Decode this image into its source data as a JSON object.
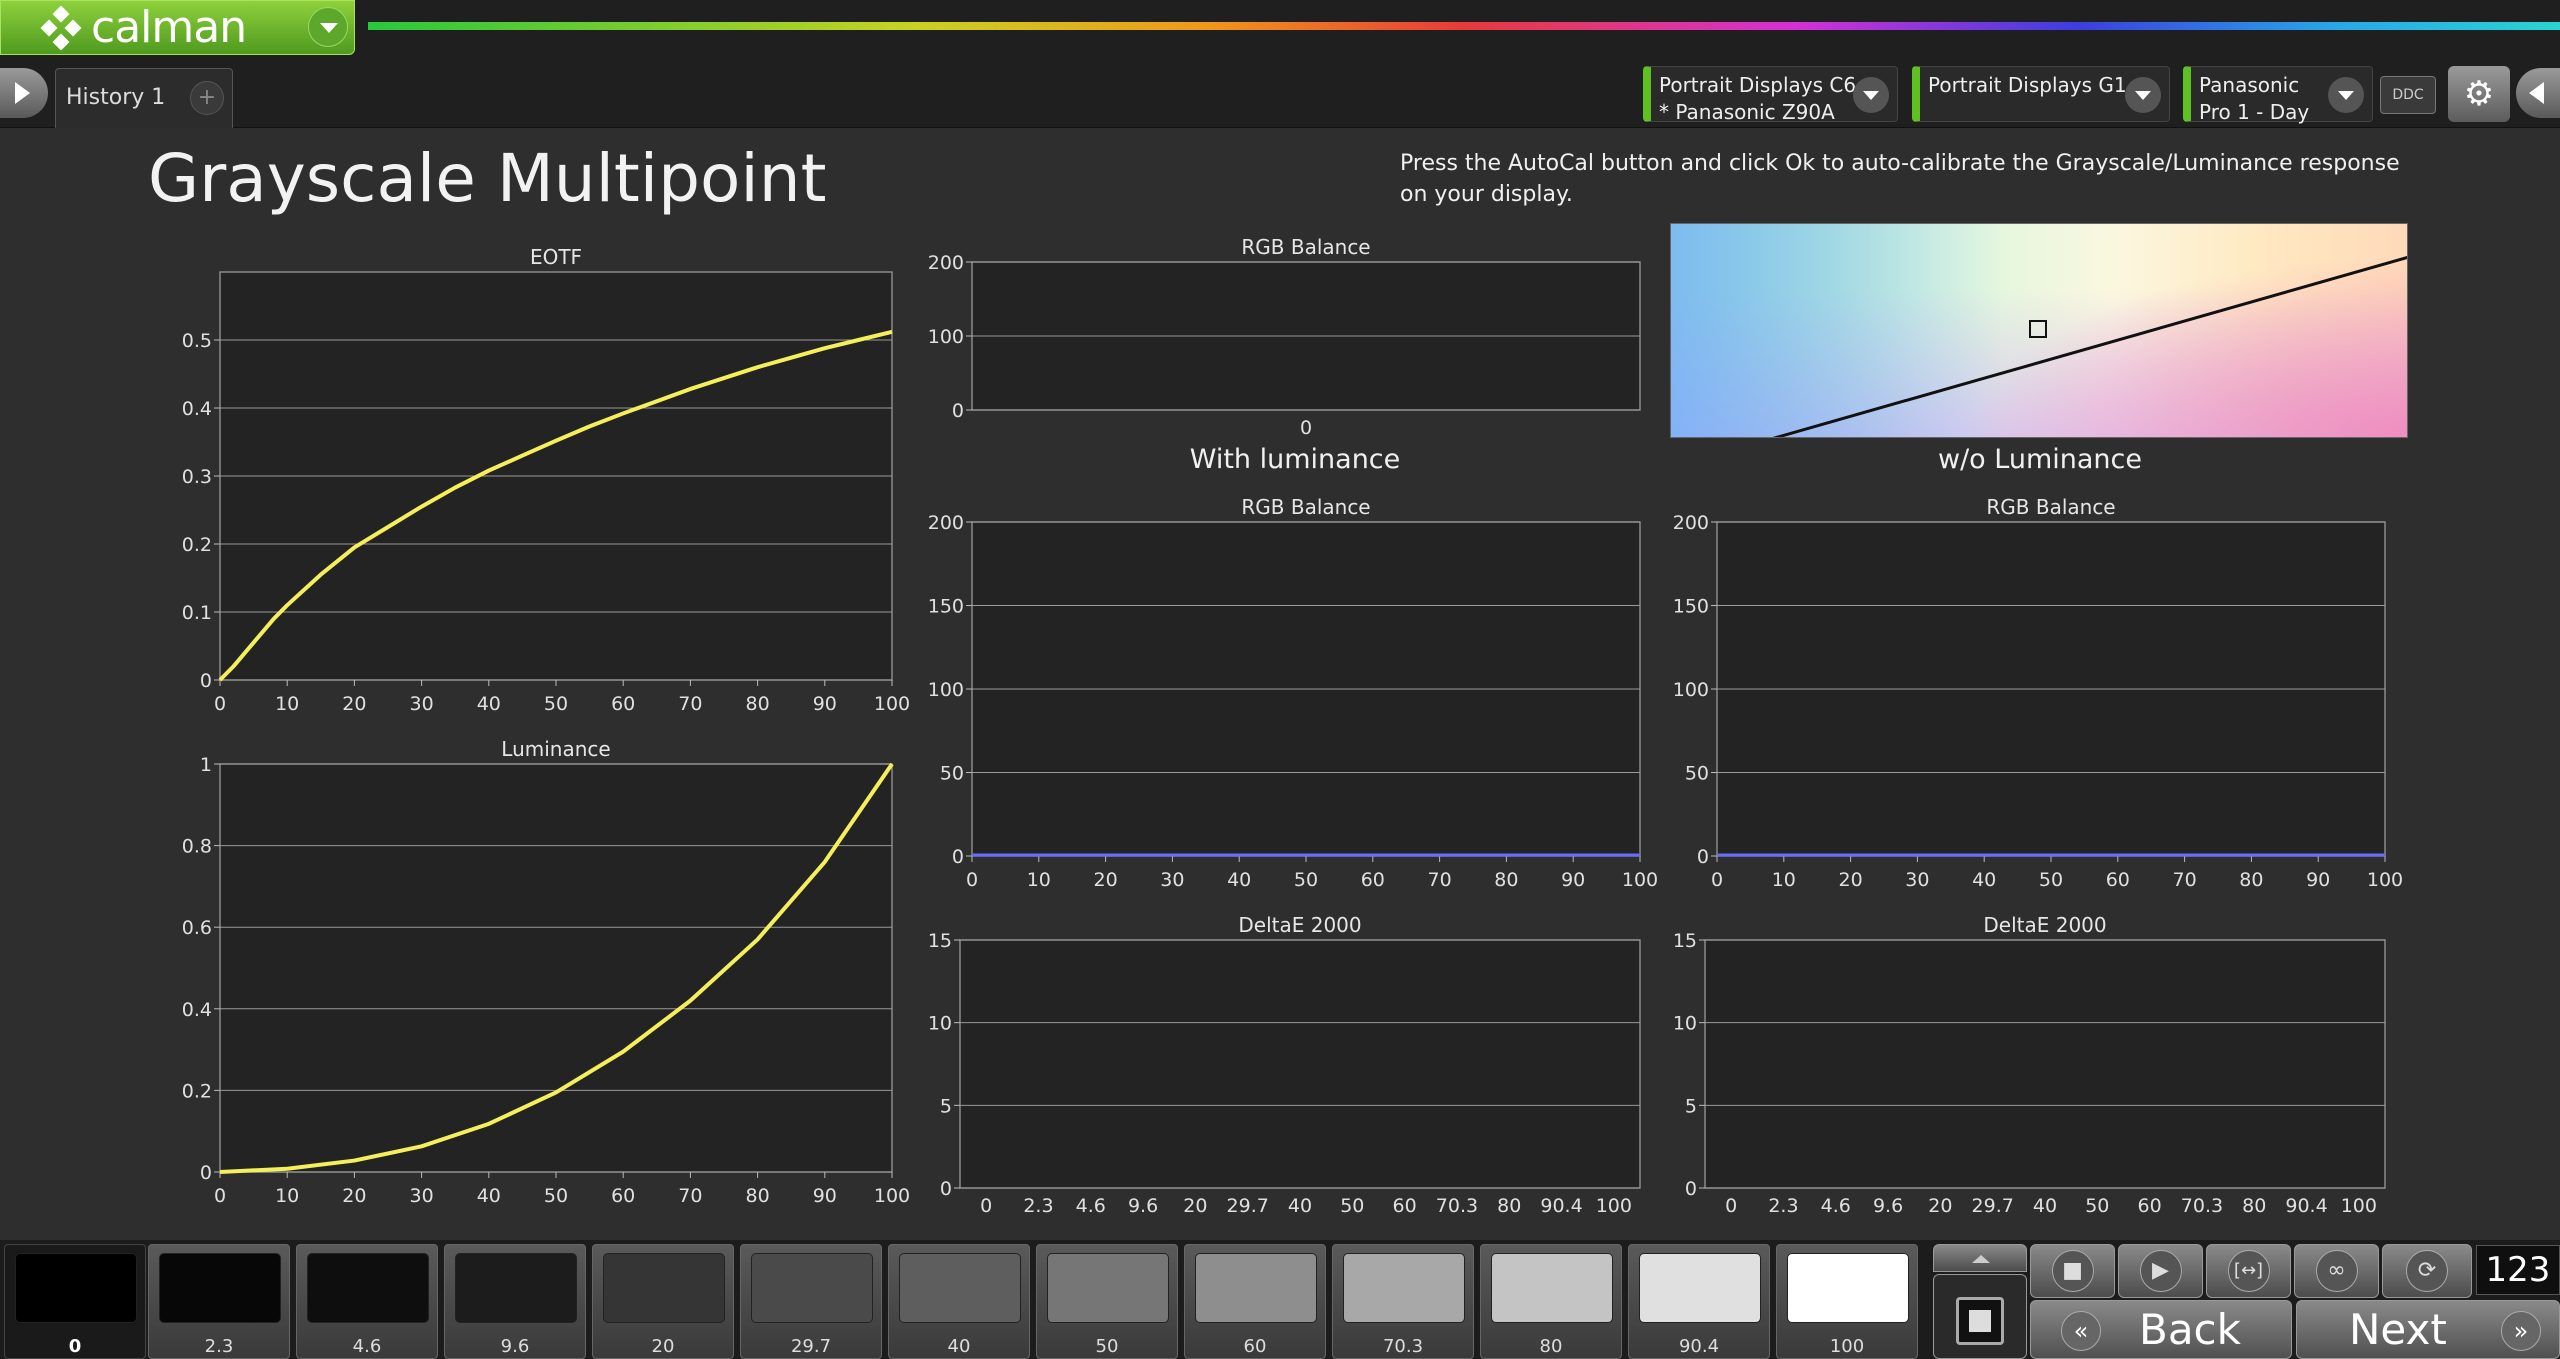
{
  "app": {
    "logo_text": "calman"
  },
  "tabs": [
    {
      "label": "History 1"
    }
  ],
  "tab_add_label": "+",
  "devices": [
    {
      "line1": "Portrait Displays C6",
      "line2": "* Panasonic Z90A"
    },
    {
      "line1": "Portrait Displays G1",
      "line2": ""
    },
    {
      "line1": "Panasonic",
      "line2": "Pro 1 - Day"
    }
  ],
  "ddc_label": "DDC",
  "page": {
    "title": "Grayscale Multipoint",
    "instructions": "Press the AutoCal button and click Ok to auto-calibrate the Grayscale/Luminance response on your display."
  },
  "sections": {
    "with_luminance": "With luminance",
    "without_luminance": "w/o Luminance"
  },
  "colors": {
    "curve": "#f5ef5a",
    "baseline": "#6a6aff",
    "accent": "#5fc022"
  },
  "chart_data": [
    {
      "id": "eotf",
      "type": "line",
      "title": "EOTF",
      "xlim": [
        0,
        100
      ],
      "ylim": [
        0,
        0.6
      ],
      "xticks": [
        0,
        10,
        20,
        30,
        40,
        50,
        60,
        70,
        80,
        90,
        100
      ],
      "yticks": [
        0,
        0.1,
        0.2,
        0.3,
        0.4,
        0.5
      ],
      "ytick_labels": [
        "0",
        "0.1",
        "0.2",
        "0.3",
        "0.4",
        "0.5"
      ],
      "series": [
        {
          "x": [
            0,
            2,
            5,
            8,
            10,
            15,
            20,
            25,
            30,
            35,
            40,
            45,
            50,
            55,
            60,
            65,
            70,
            75,
            80,
            85,
            90,
            95,
            100
          ],
          "y": [
            0,
            0.02,
            0.055,
            0.09,
            0.11,
            0.155,
            0.195,
            0.225,
            0.255,
            0.283,
            0.308,
            0.33,
            0.352,
            0.373,
            0.392,
            0.41,
            0.428,
            0.444,
            0.46,
            0.474,
            0.488,
            0.5,
            0.512
          ]
        }
      ]
    },
    {
      "id": "luminance",
      "type": "line",
      "title": "Luminance",
      "xlim": [
        0,
        100
      ],
      "ylim": [
        0,
        1
      ],
      "xticks": [
        0,
        10,
        20,
        30,
        40,
        50,
        60,
        70,
        80,
        90,
        100
      ],
      "yticks": [
        0,
        0.2,
        0.4,
        0.6,
        0.8,
        1
      ],
      "ytick_labels": [
        "0",
        "0.2",
        "0.4",
        "0.6",
        "0.8",
        "1"
      ],
      "series": [
        {
          "x": [
            0,
            10,
            20,
            30,
            40,
            50,
            60,
            70,
            80,
            90,
            100
          ],
          "y": [
            0,
            0.008,
            0.028,
            0.063,
            0.118,
            0.195,
            0.295,
            0.42,
            0.57,
            0.76,
            1.0
          ]
        }
      ]
    },
    {
      "id": "rgb-balance-top",
      "type": "bar",
      "title": "RGB Balance",
      "ylim": [
        0,
        200
      ],
      "yticks": [
        0,
        100,
        200
      ],
      "ytick_labels": [
        "0",
        "100",
        "200"
      ],
      "categories": [
        "0"
      ],
      "values": [
        0
      ]
    },
    {
      "id": "rgb-balance-with",
      "type": "line",
      "title": "RGB Balance",
      "xlim": [
        0,
        100
      ],
      "ylim": [
        0,
        200
      ],
      "xticks": [
        0,
        10,
        20,
        30,
        40,
        50,
        60,
        70,
        80,
        90,
        100
      ],
      "yticks": [
        0,
        50,
        100,
        150,
        200
      ],
      "ytick_labels": [
        "0",
        "50",
        "100",
        "150",
        "200"
      ],
      "series": [
        {
          "x": [
            0,
            100
          ],
          "y": [
            0,
            0
          ]
        }
      ]
    },
    {
      "id": "rgb-balance-without",
      "type": "line",
      "title": "RGB Balance",
      "xlim": [
        0,
        100
      ],
      "ylim": [
        0,
        200
      ],
      "xticks": [
        0,
        10,
        20,
        30,
        40,
        50,
        60,
        70,
        80,
        90,
        100
      ],
      "yticks": [
        0,
        50,
        100,
        150,
        200
      ],
      "ytick_labels": [
        "0",
        "50",
        "100",
        "150",
        "200"
      ],
      "series": [
        {
          "x": [
            0,
            100
          ],
          "y": [
            0,
            0
          ]
        }
      ]
    },
    {
      "id": "deltae-with",
      "type": "bar",
      "title": "DeltaE 2000",
      "ylim": [
        0,
        15
      ],
      "yticks": [
        0,
        5,
        10,
        15
      ],
      "ytick_labels": [
        "0",
        "5",
        "10",
        "15"
      ],
      "categories": [
        "0",
        "2.3",
        "4.6",
        "9.6",
        "20",
        "29.7",
        "40",
        "50",
        "60",
        "70.3",
        "80",
        "90.4",
        "100"
      ],
      "values": [
        0,
        0,
        0,
        0,
        0,
        0,
        0,
        0,
        0,
        0,
        0,
        0,
        0
      ]
    },
    {
      "id": "deltae-without",
      "type": "bar",
      "title": "DeltaE 2000",
      "ylim": [
        0,
        15
      ],
      "yticks": [
        0,
        5,
        10,
        15
      ],
      "ytick_labels": [
        "0",
        "5",
        "10",
        "15"
      ],
      "categories": [
        "0",
        "2.3",
        "4.6",
        "9.6",
        "20",
        "29.7",
        "40",
        "50",
        "60",
        "70.3",
        "80",
        "90.4",
        "100"
      ],
      "values": [
        0,
        0,
        0,
        0,
        0,
        0,
        0,
        0,
        0,
        0,
        0,
        0,
        0
      ]
    }
  ],
  "swatches": [
    {
      "label": "0",
      "color": "#000000",
      "active": true
    },
    {
      "label": "2.3",
      "color": "#070707"
    },
    {
      "label": "4.6",
      "color": "#0e0e0e"
    },
    {
      "label": "9.6",
      "color": "#1c1c1c"
    },
    {
      "label": "20",
      "color": "#353535"
    },
    {
      "label": "29.7",
      "color": "#4a4a4a"
    },
    {
      "label": "40",
      "color": "#5e5e5e"
    },
    {
      "label": "50",
      "color": "#767676"
    },
    {
      "label": "60",
      "color": "#8e8e8e"
    },
    {
      "label": "70.3",
      "color": "#a8a8a8"
    },
    {
      "label": "80",
      "color": "#c4c4c4"
    },
    {
      "label": "90.4",
      "color": "#e0e0e0"
    },
    {
      "label": "100",
      "color": "#ffffff"
    }
  ],
  "nav": {
    "back_label": "Back",
    "next_label": "Next",
    "counter": "123"
  }
}
